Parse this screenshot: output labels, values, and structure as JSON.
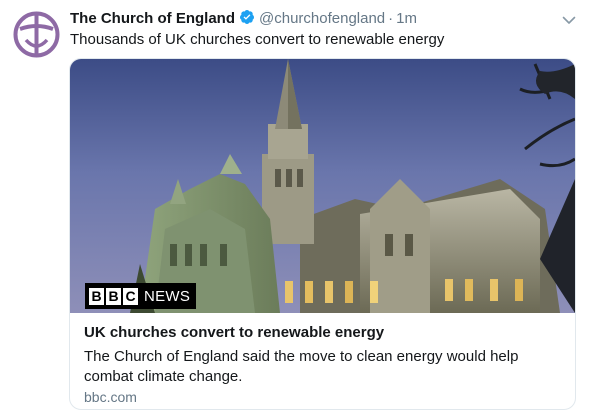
{
  "tweet": {
    "display_name": "The Church of England",
    "verified_icon": "verified-badge-icon",
    "handle": "@churchofengland",
    "separator": "·",
    "time": "1m",
    "text": "Thousands of UK churches convert to renewable energy",
    "avatar_icon": "church-cross-logo-icon",
    "more_icon": "chevron-down-icon"
  },
  "card": {
    "image_description_icon": "cathedral-photo",
    "badge": {
      "letters": [
        "B",
        "B",
        "C"
      ],
      "label": "NEWS"
    },
    "title": "UK churches convert to renewable energy",
    "description": "The Church of England said the move to clean energy would help combat climate change.",
    "domain": "bbc.com"
  },
  "colors": {
    "text": "#14171a",
    "secondary": "#657786",
    "verified": "#1da1f2",
    "logo_purple": "#8e6aa5",
    "border": "#e1e8ed"
  }
}
